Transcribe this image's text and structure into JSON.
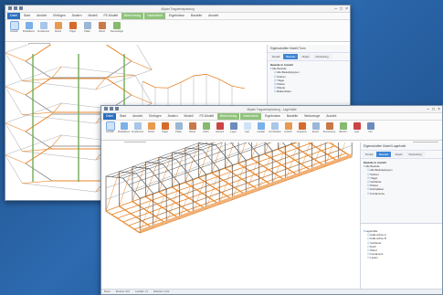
{
  "back_window": {
    "title": "Allplan Tragwerksplanung",
    "menu": [
      "Datei",
      "Start",
      "Ansicht",
      "Einfügen",
      "Ändern",
      "Modell",
      "FE-Modell",
      "Berechnung",
      "Nachweise",
      "Ergebnisse",
      "Bauteile",
      "Ansicht"
    ],
    "file_label": "Datei",
    "ribbon": [
      "Auswahl",
      "Modellieren",
      "Fundament",
      "Stütze",
      "Träger",
      "Platte",
      "Wand",
      "Bauteil-Eigenschaften"
    ],
    "option_label": "Lastfallgruppe",
    "option_value": "Alle sichtbaren",
    "panel_title": "Eigenschaften Modell Turm",
    "tabs": [
      "Modell",
      "Bauteile",
      "Objekt",
      "Darstellung"
    ],
    "tree_header": "Bauteile in Ansicht",
    "tree": [
      "Alle Bauteile",
      "Alle Bauteilgruppen",
      "Stützen",
      "Träger",
      "Platten",
      "Wände",
      "Balkenfelder"
    ]
  },
  "front_window": {
    "title": "Allplan Tragwerksplanung - Lagerhalle",
    "menu": [
      "Datei",
      "Start",
      "Ansicht",
      "Einfügen",
      "Ändern",
      "Modell",
      "FE-Modell",
      "Berechnung",
      "Nachweise",
      "Ergebnisse",
      "Bauteile",
      "Werkzeuge",
      "Ansicht"
    ],
    "ribbon": [
      "Auswahl",
      "Modellieren",
      "Fundament",
      "Stütze",
      "Träger",
      "Platte",
      "Wand",
      "Dach",
      "Verband",
      "Lager",
      "Last",
      "Lastfall",
      "Kombination",
      "Ansicht",
      "Ergebnis",
      "Export",
      "Bemessung",
      "Bericht",
      "Liste",
      "Info"
    ],
    "option_label": "Lastfallgruppe",
    "option_value": "Alle sichtbaren",
    "search_placeholder": "Suchen",
    "panel_title": "Eigenschaften Modell Lagerhalle",
    "tabs": [
      "Modell",
      "Bauteile",
      "Objekt",
      "Darstellung"
    ],
    "tree_header": "Bauteile in Ansicht",
    "tree": [
      "Alle Bauteile",
      "Alle Bauteilgruppen",
      "Stützen",
      "Träger",
      "Verbände",
      "Pfetten",
      "Dachplatten",
      "Fundamente"
    ],
    "lower_tree": [
      "Lagerhalle",
      "Halle Achse A",
      "Halle Achse B",
      "Verbände",
      "Dach",
      "Wand",
      "Fundament",
      "Lasten"
    ],
    "status": [
      "Bereit",
      "Bauteile: 824",
      "Lastfälle: 12",
      "Maßstab 1:100"
    ]
  },
  "colors": {
    "accent_blue": "#2b6fc0",
    "member_orange": "#e8862a",
    "frame_gray": "#555555",
    "context_green": "#8fc27b"
  }
}
